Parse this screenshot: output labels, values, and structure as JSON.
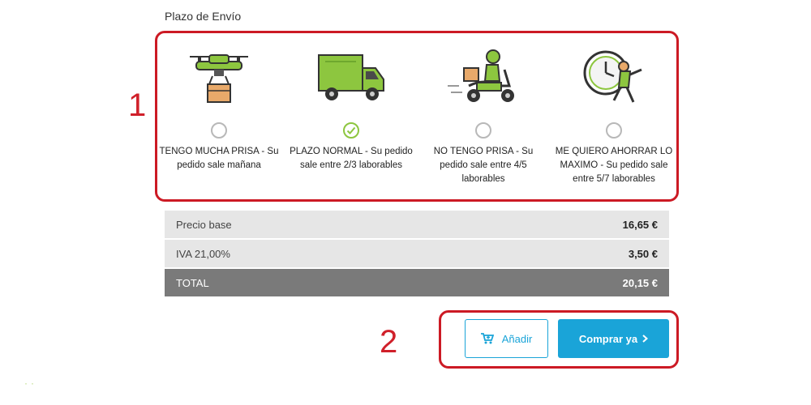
{
  "section_title": "Plazo de Envío",
  "annotations": {
    "box1_number": "1",
    "box2_number": "2"
  },
  "shipping_options": [
    {
      "illustration": "drone-delivery-icon",
      "label": "TENGO MUCHA PRISA - Su pedido sale mañana",
      "selected": false
    },
    {
      "illustration": "truck-icon",
      "label": "PLAZO NORMAL - Su pedido sale entre 2/3 laborables",
      "selected": true
    },
    {
      "illustration": "scooter-delivery-icon",
      "label": "NO TENGO PRISA - Su pedido sale entre 4/5 laborables",
      "selected": false
    },
    {
      "illustration": "clock-runner-icon",
      "label": "ME QUIERO AHORRAR LO MAXIMO - Su pedido sale entre 5/7 laborables",
      "selected": false
    }
  ],
  "price_table": [
    {
      "label": "Precio base",
      "value": "16,65 €"
    },
    {
      "label": "IVA 21,00%",
      "value": "3,50 €"
    },
    {
      "label": "TOTAL",
      "value": "20,15 €"
    }
  ],
  "buttons": {
    "add_label": "Añadir",
    "buy_label": "Comprar ya"
  },
  "colors": {
    "accent": "#1aa4d8",
    "selected": "#8dc63f",
    "annotation": "#cc1a24",
    "total_bg": "#7a7a7a"
  }
}
